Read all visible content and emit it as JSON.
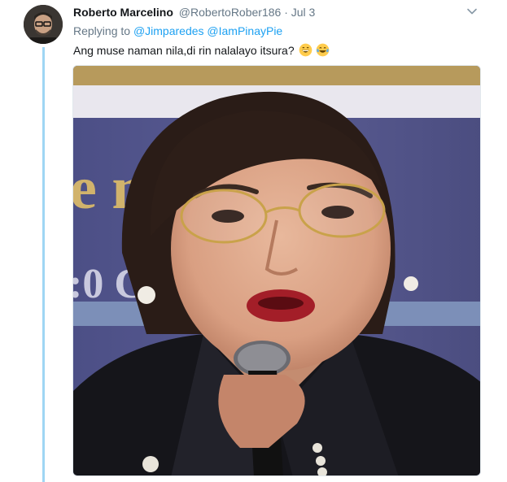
{
  "tweet": {
    "author_name": "Roberto Marcelino",
    "author_handle": "@RobertoRober186",
    "separator": "·",
    "date": "Jul 3",
    "replying_to_label": "Replying to",
    "mentions": [
      "@Jimparedes",
      "@IamPinayPie"
    ],
    "text": "Ang muse naman nila,di rin nalalayo itsura?",
    "emojis": [
      "grinning-face-emoji",
      "tears-of-joy-emoji"
    ]
  },
  "photo": {
    "banner_text_top": "e   mo",
    "banner_text_bottom": ":0   Club"
  },
  "colors": {
    "link": "#1da1f2",
    "secondary_text": "#657786",
    "thread_line": "#9fd6f4"
  }
}
